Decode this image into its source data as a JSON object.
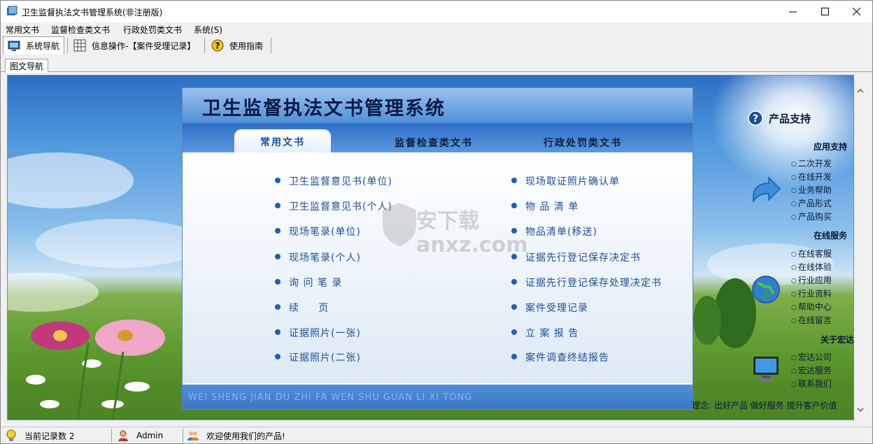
{
  "window": {
    "title": "卫生监督执法文书管理系统(非注册版)",
    "minimize_icon": "minimize-icon",
    "maximize_icon": "maximize-icon",
    "close_icon": "close-icon"
  },
  "menu": [
    "常用文书",
    "监督检查类文书",
    "行政处罚类文书",
    "系统(S)"
  ],
  "toolbar": {
    "tabs": [
      {
        "label": "系统导航",
        "icon": "monitor-icon"
      },
      {
        "label": "信息操作-【案件受理记录】",
        "icon": "grid-icon"
      },
      {
        "label": "使用指南",
        "icon": "help-icon"
      }
    ]
  },
  "subtab": "图文导航",
  "panel": {
    "title": "卫生监督执法文书管理系统",
    "tabs": [
      "常用文书",
      "监督检查类文书",
      "行政处罚类文书"
    ],
    "left_links": [
      "卫生监督意见书(单位)",
      "卫生监督意见书(个人)",
      "现场笔录(单位)",
      "现场笔录(个人)",
      "询 问 笔 录",
      "续     页",
      "证据照片(一张)",
      "证据照片(二张)"
    ],
    "right_links": [
      "现场取证照片确认单",
      "物 品 清 单",
      "物品清单(移送)",
      "证据先行登记保存决定书",
      "证据先行登记保存处理决定书",
      "案件受理记录",
      "立 案 报 告",
      "案件调查终结报告"
    ],
    "footer": "WEI SHENG JIAN DU ZHI FA WEN SHU GUAN LI XI TONG"
  },
  "side": {
    "title": "产品支持",
    "sections": [
      {
        "heading": "应用支持",
        "links": [
          "二次开发",
          "在线开发",
          "业务帮助",
          "产品形式",
          "产品购买"
        ]
      },
      {
        "heading": "在线服务",
        "links": [
          "在线客服",
          "在线体验",
          "行业应用",
          "行业资料",
          "帮助中心",
          "在线留言"
        ]
      },
      {
        "heading": "关于宏达",
        "links": [
          "宏达公司",
          "宏达服务",
          "联系我们"
        ]
      }
    ],
    "slogan": "理念: 出好产品 做好服务 提升客户价值"
  },
  "statusbar": {
    "record": "当前记录数 2",
    "user": "Admin",
    "welcome": "欢迎使用我们的产品!"
  },
  "watermark": "安下载 anxz.com",
  "colors": {
    "accent": "#1c5fb4",
    "panel_head": "#4f8fd9"
  }
}
